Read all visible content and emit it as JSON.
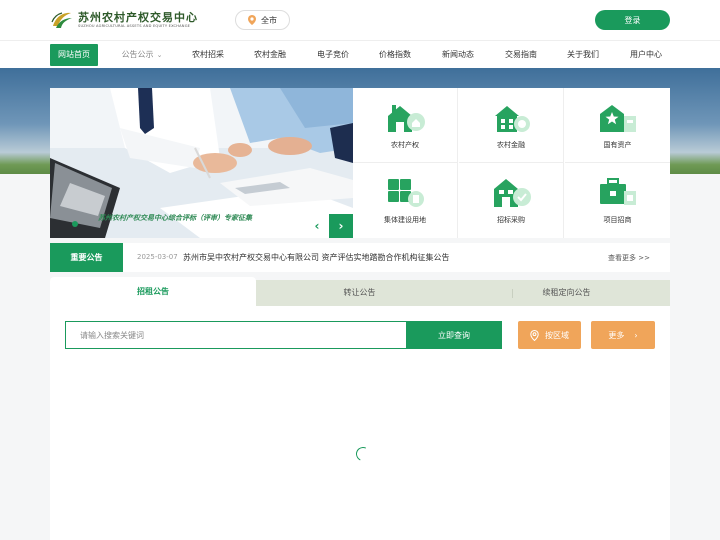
{
  "header": {
    "logo_cn": "苏州农村产权交易中心",
    "logo_en": "SUZHOU AGRICULTURAL ASSETS AND EQUITY EXCHANGE",
    "city": "全市",
    "login": "登录"
  },
  "nav": {
    "items": [
      {
        "label": "网站首页",
        "active": true
      },
      {
        "label": "公告公示",
        "has_dropdown": true
      },
      {
        "label": "农村招采"
      },
      {
        "label": "农村金融"
      },
      {
        "label": "电子竞价"
      },
      {
        "label": "价格指数"
      },
      {
        "label": "新闻动态"
      },
      {
        "label": "交易指南"
      },
      {
        "label": "关于我们"
      },
      {
        "label": "用户中心"
      }
    ]
  },
  "banner": {
    "caption": "苏州农村产权交易中心综合评标（评审）专家征集",
    "prev": "‹",
    "next": "›"
  },
  "services": [
    {
      "label": "农村产权",
      "icon": "house-icon"
    },
    {
      "label": "农村金融",
      "icon": "bank-building-icon"
    },
    {
      "label": "国有资产",
      "icon": "star-building-icon"
    },
    {
      "label": "集体建设用地",
      "icon": "land-grid-icon"
    },
    {
      "label": "招标采购",
      "icon": "shop-icon"
    },
    {
      "label": "项目招商",
      "icon": "briefcase-icon"
    }
  ],
  "notice": {
    "tag": "重要公告",
    "date": "2025-03-07",
    "text": "苏州市吴中农村产权交易中心有限公司 资产评估实地踏勘合作机构征集公告",
    "more": "查看更多 >>"
  },
  "tabs": [
    {
      "label": "招租公告",
      "active": true
    },
    {
      "label": "转让公告"
    },
    {
      "label": "续租定向公告"
    }
  ],
  "search": {
    "placeholder": "请输入搜索关键词",
    "value": "",
    "submit": "立即查询",
    "area_button": "按区域",
    "more_button": "更多"
  },
  "colors": {
    "brand_green": "#1a9a5c",
    "accent_orange": "#f0a55a",
    "tab_bar": "#dfe5d8"
  }
}
